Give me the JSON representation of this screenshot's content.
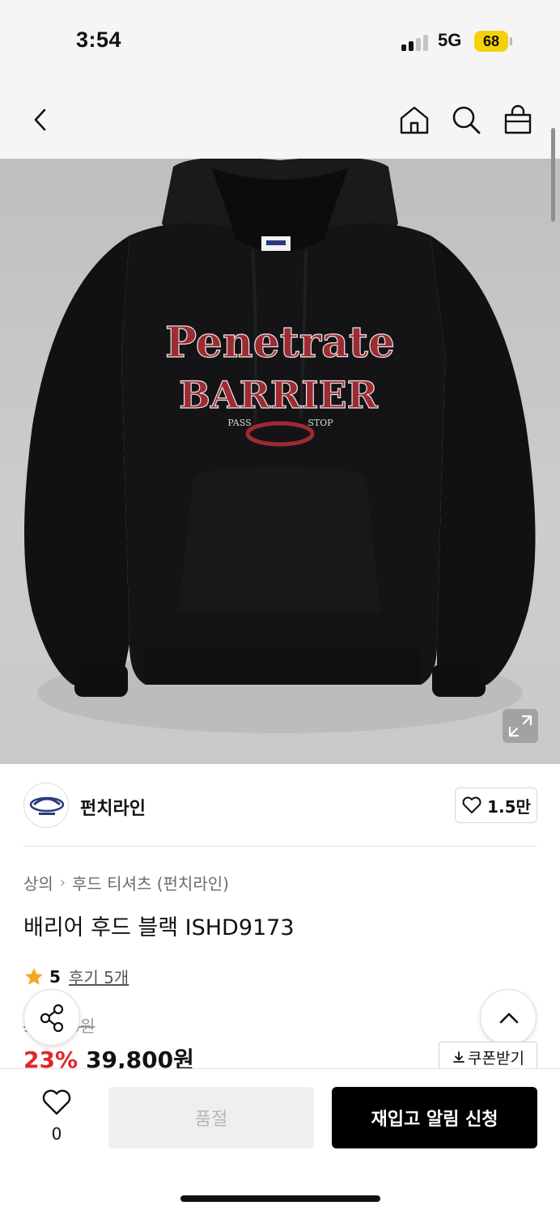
{
  "status_bar": {
    "time": "3:54",
    "network": "5G",
    "battery": "68"
  },
  "nav": {
    "icons": [
      "chevron-left-icon",
      "home-icon",
      "search-icon",
      "shopping-bag-icon"
    ]
  },
  "product_image": {
    "print_line1": "Penetrate",
    "print_line2": "BARRIER",
    "print_left": "PASS",
    "print_right": "STOP",
    "print_color": "#9e2b32",
    "hoodie_color": "#141416"
  },
  "brand": {
    "name": "펀치라인",
    "likes": "1.5만"
  },
  "breadcrumb": {
    "items": [
      "상의",
      "후드 티셔츠 (펀치라인)"
    ]
  },
  "product": {
    "title": "배리어 후드 블랙 ISHD9173",
    "rating": "5",
    "reviews": "후기 5개",
    "original_price": "51,900원",
    "discount": "23%",
    "price": "39,800원",
    "coupon": "쿠폰받기"
  },
  "bottom_bar": {
    "wish_count": "0",
    "soldout_label": "품절",
    "restock_label": "재입고 알림 신청"
  },
  "colors": {
    "accent_red": "#e0262b",
    "star": "#f5a623"
  }
}
